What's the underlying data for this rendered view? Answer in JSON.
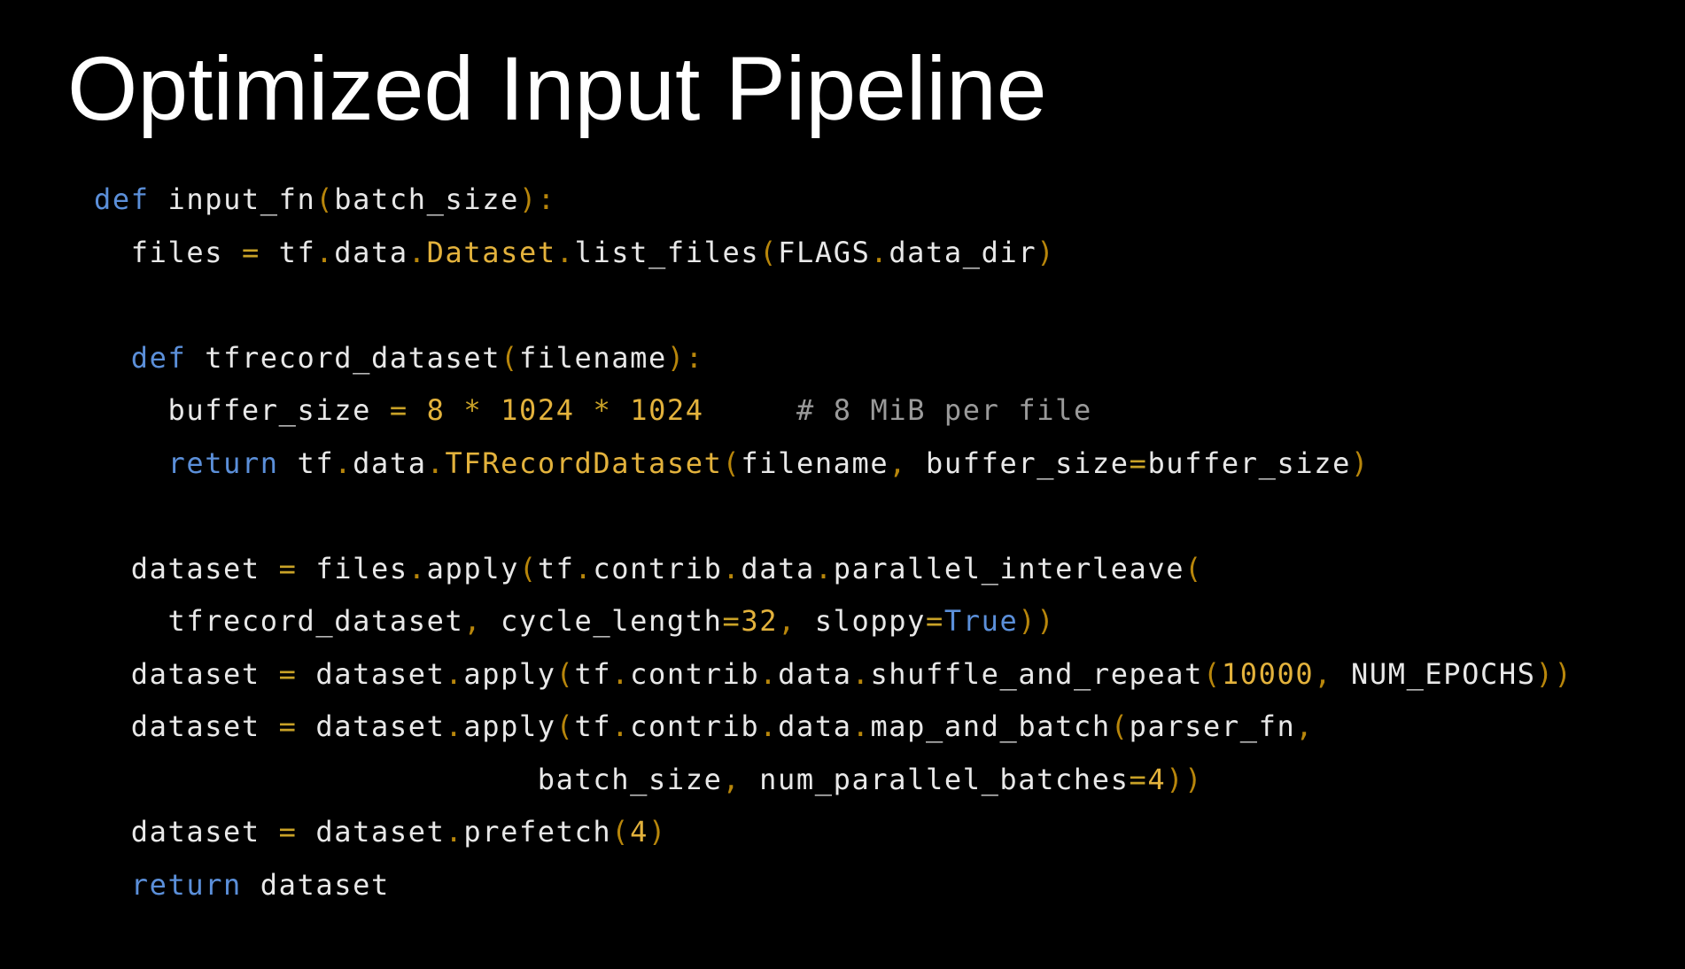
{
  "slide": {
    "title": "Optimized Input Pipeline"
  },
  "colors": {
    "background": "#000000",
    "title": "#ffffff",
    "plain": "#e8e8e8",
    "keyword": "#5b8fd9",
    "class_or_number": "#e3b23c",
    "punctuation": "#b8860b",
    "operator": "#c9a227",
    "comment": "#9a9a9a"
  },
  "code_lines": [
    [
      {
        "t": "kw",
        "v": "def"
      },
      {
        "t": "plain",
        "v": " input_fn"
      },
      {
        "t": "punc",
        "v": "("
      },
      {
        "t": "plain",
        "v": "batch_size"
      },
      {
        "t": "punc",
        "v": "):"
      }
    ],
    [
      {
        "t": "plain",
        "v": "  files "
      },
      {
        "t": "op",
        "v": "="
      },
      {
        "t": "plain",
        "v": " tf"
      },
      {
        "t": "punc",
        "v": "."
      },
      {
        "t": "plain",
        "v": "data"
      },
      {
        "t": "punc",
        "v": "."
      },
      {
        "t": "cls",
        "v": "Dataset"
      },
      {
        "t": "punc",
        "v": "."
      },
      {
        "t": "plain",
        "v": "list_files"
      },
      {
        "t": "punc",
        "v": "("
      },
      {
        "t": "plain",
        "v": "FLAGS"
      },
      {
        "t": "punc",
        "v": "."
      },
      {
        "t": "plain",
        "v": "data_dir"
      },
      {
        "t": "punc",
        "v": ")"
      }
    ],
    [],
    [
      {
        "t": "plain",
        "v": "  "
      },
      {
        "t": "kw",
        "v": "def"
      },
      {
        "t": "plain",
        "v": " tfrecord_dataset"
      },
      {
        "t": "punc",
        "v": "("
      },
      {
        "t": "plain",
        "v": "filename"
      },
      {
        "t": "punc",
        "v": "):"
      }
    ],
    [
      {
        "t": "plain",
        "v": "    buffer_size "
      },
      {
        "t": "op",
        "v": "="
      },
      {
        "t": "plain",
        "v": " "
      },
      {
        "t": "num",
        "v": "8"
      },
      {
        "t": "plain",
        "v": " "
      },
      {
        "t": "op",
        "v": "*"
      },
      {
        "t": "plain",
        "v": " "
      },
      {
        "t": "num",
        "v": "1024"
      },
      {
        "t": "plain",
        "v": " "
      },
      {
        "t": "op",
        "v": "*"
      },
      {
        "t": "plain",
        "v": " "
      },
      {
        "t": "num",
        "v": "1024"
      },
      {
        "t": "plain",
        "v": "     "
      },
      {
        "t": "comment",
        "v": "# 8 MiB per file"
      }
    ],
    [
      {
        "t": "plain",
        "v": "    "
      },
      {
        "t": "kw",
        "v": "return"
      },
      {
        "t": "plain",
        "v": " tf"
      },
      {
        "t": "punc",
        "v": "."
      },
      {
        "t": "plain",
        "v": "data"
      },
      {
        "t": "punc",
        "v": "."
      },
      {
        "t": "cls",
        "v": "TFRecordDataset"
      },
      {
        "t": "punc",
        "v": "("
      },
      {
        "t": "plain",
        "v": "filename"
      },
      {
        "t": "punc",
        "v": ","
      },
      {
        "t": "plain",
        "v": " buffer_size"
      },
      {
        "t": "op",
        "v": "="
      },
      {
        "t": "plain",
        "v": "buffer_size"
      },
      {
        "t": "punc",
        "v": ")"
      }
    ],
    [],
    [
      {
        "t": "plain",
        "v": "  dataset "
      },
      {
        "t": "op",
        "v": "="
      },
      {
        "t": "plain",
        "v": " files"
      },
      {
        "t": "punc",
        "v": "."
      },
      {
        "t": "plain",
        "v": "apply"
      },
      {
        "t": "punc",
        "v": "("
      },
      {
        "t": "plain",
        "v": "tf"
      },
      {
        "t": "punc",
        "v": "."
      },
      {
        "t": "plain",
        "v": "contrib"
      },
      {
        "t": "punc",
        "v": "."
      },
      {
        "t": "plain",
        "v": "data"
      },
      {
        "t": "punc",
        "v": "."
      },
      {
        "t": "plain",
        "v": "parallel_interleave"
      },
      {
        "t": "punc",
        "v": "("
      }
    ],
    [
      {
        "t": "plain",
        "v": "    tfrecord_dataset"
      },
      {
        "t": "punc",
        "v": ","
      },
      {
        "t": "plain",
        "v": " cycle_length"
      },
      {
        "t": "op",
        "v": "="
      },
      {
        "t": "num",
        "v": "32"
      },
      {
        "t": "punc",
        "v": ","
      },
      {
        "t": "plain",
        "v": " sloppy"
      },
      {
        "t": "op",
        "v": "="
      },
      {
        "t": "const",
        "v": "True"
      },
      {
        "t": "punc",
        "v": "))"
      }
    ],
    [
      {
        "t": "plain",
        "v": "  dataset "
      },
      {
        "t": "op",
        "v": "="
      },
      {
        "t": "plain",
        "v": " dataset"
      },
      {
        "t": "punc",
        "v": "."
      },
      {
        "t": "plain",
        "v": "apply"
      },
      {
        "t": "punc",
        "v": "("
      },
      {
        "t": "plain",
        "v": "tf"
      },
      {
        "t": "punc",
        "v": "."
      },
      {
        "t": "plain",
        "v": "contrib"
      },
      {
        "t": "punc",
        "v": "."
      },
      {
        "t": "plain",
        "v": "data"
      },
      {
        "t": "punc",
        "v": "."
      },
      {
        "t": "plain",
        "v": "shuffle_and_repeat"
      },
      {
        "t": "punc",
        "v": "("
      },
      {
        "t": "num",
        "v": "10000"
      },
      {
        "t": "punc",
        "v": ","
      },
      {
        "t": "plain",
        "v": " NUM_EPOCHS"
      },
      {
        "t": "punc",
        "v": "))"
      }
    ],
    [
      {
        "t": "plain",
        "v": "  dataset "
      },
      {
        "t": "op",
        "v": "="
      },
      {
        "t": "plain",
        "v": " dataset"
      },
      {
        "t": "punc",
        "v": "."
      },
      {
        "t": "plain",
        "v": "apply"
      },
      {
        "t": "punc",
        "v": "("
      },
      {
        "t": "plain",
        "v": "tf"
      },
      {
        "t": "punc",
        "v": "."
      },
      {
        "t": "plain",
        "v": "contrib"
      },
      {
        "t": "punc",
        "v": "."
      },
      {
        "t": "plain",
        "v": "data"
      },
      {
        "t": "punc",
        "v": "."
      },
      {
        "t": "plain",
        "v": "map_and_batch"
      },
      {
        "t": "punc",
        "v": "("
      },
      {
        "t": "plain",
        "v": "parser_fn"
      },
      {
        "t": "punc",
        "v": ","
      }
    ],
    [
      {
        "t": "plain",
        "v": "                        batch_size"
      },
      {
        "t": "punc",
        "v": ","
      },
      {
        "t": "plain",
        "v": " num_parallel_batches"
      },
      {
        "t": "op",
        "v": "="
      },
      {
        "t": "num",
        "v": "4"
      },
      {
        "t": "punc",
        "v": "))"
      }
    ],
    [
      {
        "t": "plain",
        "v": "  dataset "
      },
      {
        "t": "op",
        "v": "="
      },
      {
        "t": "plain",
        "v": " dataset"
      },
      {
        "t": "punc",
        "v": "."
      },
      {
        "t": "plain",
        "v": "prefetch"
      },
      {
        "t": "punc",
        "v": "("
      },
      {
        "t": "num",
        "v": "4"
      },
      {
        "t": "punc",
        "v": ")"
      }
    ],
    [
      {
        "t": "plain",
        "v": "  "
      },
      {
        "t": "kw",
        "v": "return"
      },
      {
        "t": "plain",
        "v": " dataset"
      }
    ]
  ]
}
